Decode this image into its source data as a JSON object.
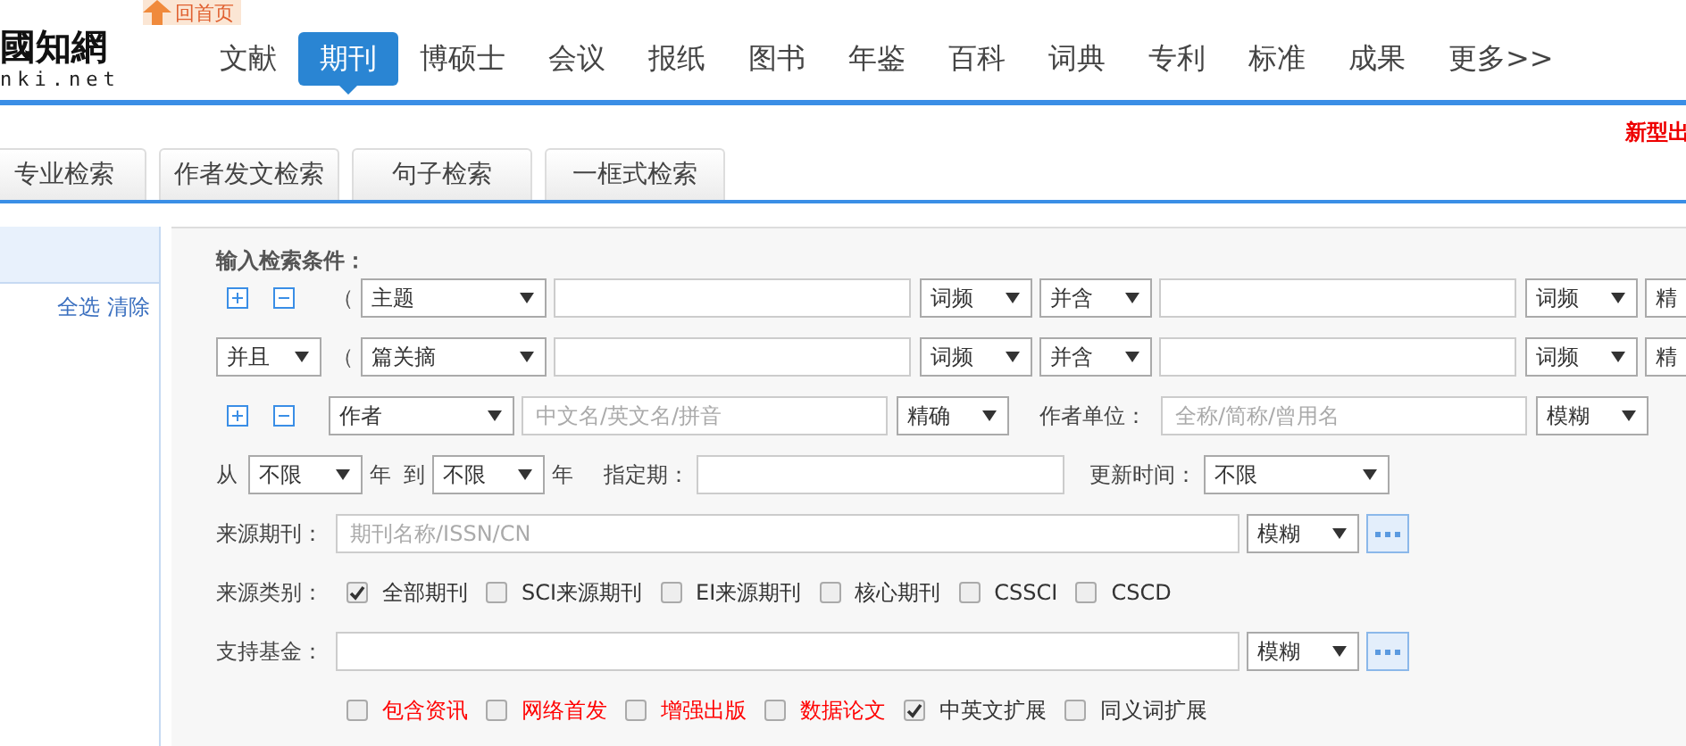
{
  "header": {
    "logo": "國知網",
    "logo_domain": "nki.net",
    "home_link": "回首页",
    "nav": [
      {
        "label": "文献",
        "selected": false
      },
      {
        "label": "期刊",
        "selected": true
      },
      {
        "label": "博硕士",
        "selected": false
      },
      {
        "label": "会议",
        "selected": false
      },
      {
        "label": "报纸",
        "selected": false
      },
      {
        "label": "图书",
        "selected": false
      },
      {
        "label": "年鉴",
        "selected": false
      },
      {
        "label": "百科",
        "selected": false
      },
      {
        "label": "词典",
        "selected": false
      },
      {
        "label": "专利",
        "selected": false
      },
      {
        "label": "标准",
        "selected": false
      },
      {
        "label": "成果",
        "selected": false
      },
      {
        "label": "更多>>",
        "selected": false
      }
    ]
  },
  "notice": "新型出",
  "search_tabs": [
    "专业检索",
    "作者发文检索",
    "句子检索",
    "一框式检索"
  ],
  "sidebar": {
    "select_all": "全选",
    "clear": "清除"
  },
  "form": {
    "title": "输入检索条件：",
    "conditions": [
      {
        "kind": "first",
        "paren": "（",
        "field": "主题",
        "freq1": "词频",
        "relation": "并含",
        "freq2": "词频",
        "match": "精"
      },
      {
        "kind": "logic",
        "logic": "并且",
        "paren": "（",
        "field": "篇关摘",
        "freq1": "词频",
        "relation": "并含",
        "freq2": "词频",
        "match": "精"
      }
    ],
    "author": {
      "field": "作者",
      "placeholder": "中文名/英文名/拼音",
      "match": "精确",
      "org_label": "作者单位：",
      "org_placeholder": "全称/简称/曾用名",
      "org_match": "模糊"
    },
    "dates": {
      "from_label": "从",
      "from": "不限",
      "year1": "年",
      "to_label": "到",
      "to": "不限",
      "year2": "年",
      "period_label": "指定期：",
      "update_label": "更新时间：",
      "update": "不限"
    },
    "source": {
      "label": "来源期刊：",
      "placeholder": "期刊名称/ISSN/CN",
      "match": "模糊"
    },
    "categories": {
      "label": "来源类别：",
      "items": [
        {
          "label": "全部期刊",
          "checked": true
        },
        {
          "label": "SCI来源期刊",
          "checked": false
        },
        {
          "label": "EI来源期刊",
          "checked": false
        },
        {
          "label": "核心期刊",
          "checked": false
        },
        {
          "label": "CSSCI",
          "checked": false
        },
        {
          "label": "CSCD",
          "checked": false
        }
      ]
    },
    "fund": {
      "label": "支持基金：",
      "match": "模糊"
    },
    "options": [
      {
        "label": "包含资讯",
        "checked": false,
        "color": "#ff0000"
      },
      {
        "label": "网络首发",
        "checked": false,
        "color": "#ff0000"
      },
      {
        "label": "增强出版",
        "checked": false,
        "color": "#ff0000"
      },
      {
        "label": "数据论文",
        "checked": false,
        "color": "#ff0000"
      },
      {
        "label": "中英文扩展",
        "checked": true,
        "color": "#333333"
      },
      {
        "label": "同义词扩展",
        "checked": false,
        "color": "#333333"
      }
    ]
  }
}
